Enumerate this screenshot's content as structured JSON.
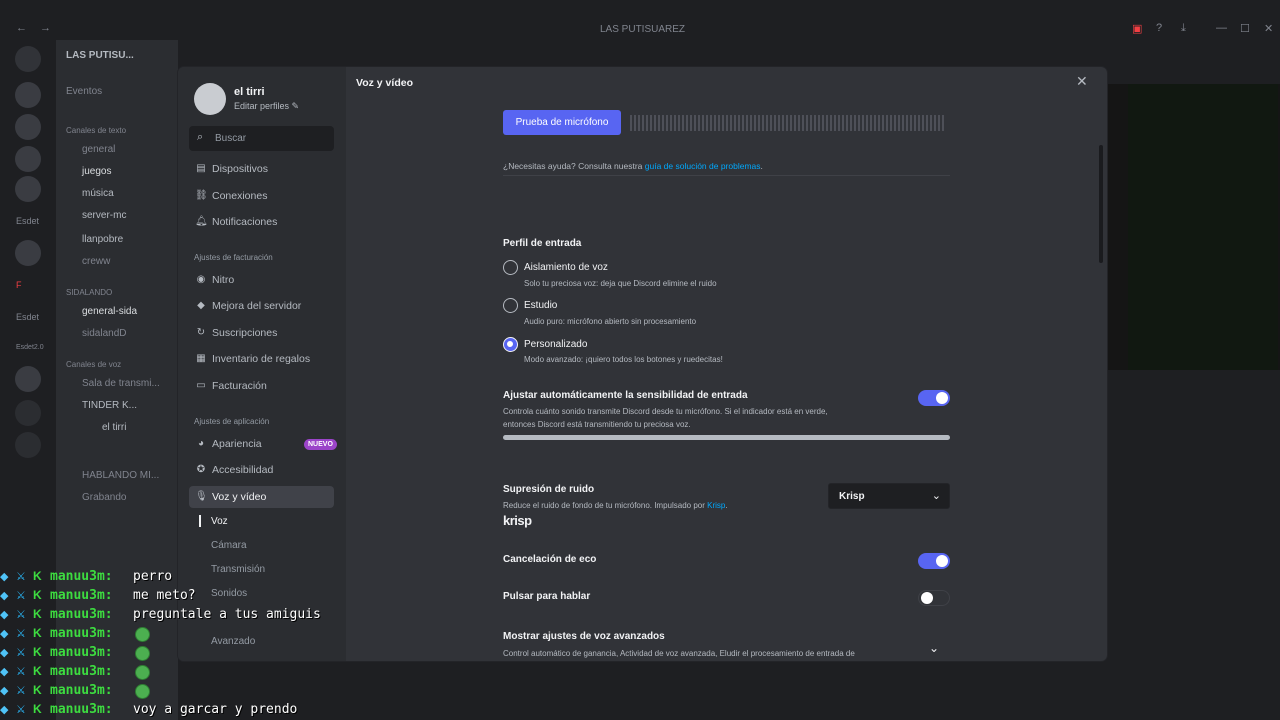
{
  "window": {
    "title": "LAS PUTISUAREZ"
  },
  "background": {
    "server_name": "LAS PUTISU...",
    "events": "Eventos",
    "categories": [
      "Canales de texto",
      "SIDALANDO",
      "Canales de voz"
    ],
    "channels": [
      "general",
      "juegos",
      "música",
      "server-mc",
      "llanpobre",
      "creww",
      "general-sida",
      "sidalandD",
      "Sala de transmi...",
      "TINDER K...",
      "el tirri",
      "HABLANDO MI...",
      "Grabando"
    ],
    "server_labels": [
      "Esdet",
      "F",
      "Esdet",
      "Esdet2.0"
    ]
  },
  "profile": {
    "name": "el tirri",
    "edit": "Editar perfiles"
  },
  "search": {
    "placeholder": "Buscar"
  },
  "nav": {
    "group1": [
      {
        "label": "Dispositivos",
        "icon": "devices-icon"
      },
      {
        "label": "Conexiones",
        "icon": "link-icon"
      },
      {
        "label": "Notificaciones",
        "icon": "bell-icon"
      }
    ],
    "billing_header": "Ajustes de facturación",
    "group2": [
      {
        "label": "Nitro",
        "icon": "nitro-icon"
      },
      {
        "label": "Mejora del servidor",
        "icon": "boost-icon"
      },
      {
        "label": "Suscripciones",
        "icon": "subscriptions-icon"
      },
      {
        "label": "Inventario de regalos",
        "icon": "gift-icon"
      },
      {
        "label": "Facturación",
        "icon": "card-icon"
      }
    ],
    "app_header": "Ajustes de aplicación",
    "group3": [
      {
        "label": "Apariencia",
        "icon": "palette-icon",
        "badge": "NUEVO"
      },
      {
        "label": "Accesibilidad",
        "icon": "accessibility-icon"
      },
      {
        "label": "Voz y vídeo",
        "icon": "mic-icon"
      }
    ],
    "subitems": [
      "Voz",
      "Cámara",
      "Transmisión",
      "Sonidos",
      "Avanzado"
    ]
  },
  "content": {
    "title": "Voz y vídeo",
    "mic_test_button": "Prueba de micrófono",
    "help_text": "¿Necesitas ayuda? Consulta nuestra ",
    "help_link": "guía de solución de problemas",
    "help_end": ".",
    "input_profile": {
      "heading": "Perfil de entrada",
      "options": [
        {
          "title": "Aislamiento de voz",
          "desc": "Solo tu preciosa voz: deja que Discord elimine el ruido",
          "selected": false
        },
        {
          "title": "Estudio",
          "desc": "Audio puro: micrófono abierto sin procesamiento",
          "selected": false
        },
        {
          "title": "Personalizado",
          "desc": "Modo avanzado: ¡quiero todos los botones y ruedecitas!",
          "selected": true
        }
      ]
    },
    "auto_sensitivity": {
      "title": "Ajustar automáticamente la sensibilidad de entrada",
      "desc1": "Controla cuánto sonido transmite Discord desde tu micrófono. Si el indicador está en verde,",
      "desc2": "entonces Discord está transmitiendo tu preciosa voz.",
      "enabled": true
    },
    "noise": {
      "title": "Supresión de ruido",
      "desc": "Reduce el ruido de fondo de tu micrófono. Impulsado por ",
      "link": "Krisp",
      "desc_end": ".",
      "selected": "Krisp",
      "logo": "krisp"
    },
    "echo": {
      "title": "Cancelación de eco",
      "enabled": true
    },
    "ptt": {
      "title": "Pulsar para hablar",
      "enabled": false
    },
    "advanced": {
      "title": "Mostrar ajustes de voz avanzados",
      "desc": "Control automático de ganancia, Actividad de voz avanzada, Eludir el procesamiento de entrada de"
    }
  },
  "chat": [
    {
      "user": "manuu3m:",
      "text": "perro"
    },
    {
      "user": "manuu3m:",
      "text": "me meto?"
    },
    {
      "user": "manuu3m:",
      "text": "preguntale a tus amiguis"
    },
    {
      "user": "manuu3m:",
      "text": ""
    },
    {
      "user": "manuu3m:",
      "text": ""
    },
    {
      "user": "manuu3m:",
      "text": ""
    },
    {
      "user": "manuu3m:",
      "text": ""
    },
    {
      "user": "manuu3m:",
      "text": "voy a garcar y prendo"
    }
  ],
  "chat_badge": "K"
}
